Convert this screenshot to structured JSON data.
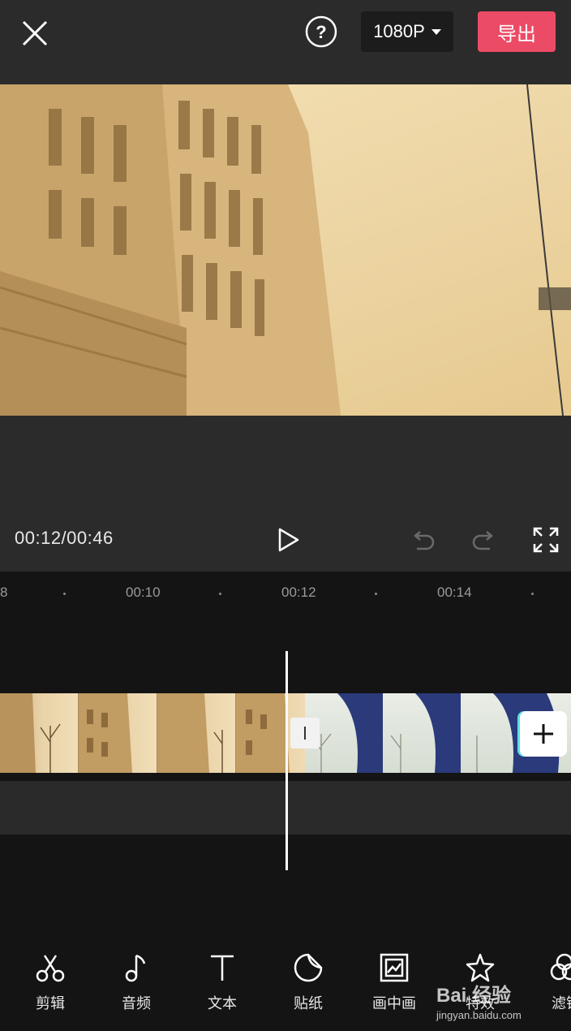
{
  "topbar": {
    "close_icon": "close-icon",
    "help_icon": "help-icon",
    "resolution": "1080P",
    "export_label": "导出"
  },
  "player": {
    "time_readout": "00:12/00:46",
    "play_icon": "play-icon",
    "undo_icon": "undo-icon",
    "redo_icon": "redo-icon",
    "fullscreen_icon": "fullscreen-icon"
  },
  "timeline": {
    "ticks": [
      {
        "label": "8"
      },
      {
        "label": "00:10"
      },
      {
        "label": "00:12"
      },
      {
        "label": "00:14"
      }
    ],
    "add_clip_icon": "plus-icon"
  },
  "toolbar": {
    "items": [
      {
        "label": "剪辑",
        "icon": "scissors-icon"
      },
      {
        "label": "音频",
        "icon": "music-note-icon"
      },
      {
        "label": "文本",
        "icon": "text-icon"
      },
      {
        "label": "贴纸",
        "icon": "sticker-icon"
      },
      {
        "label": "画中画",
        "icon": "picture-in-picture-icon"
      },
      {
        "label": "特效",
        "icon": "star-effects-icon"
      },
      {
        "label": "滤镜",
        "icon": "filter-icon"
      }
    ]
  },
  "watermark": {
    "main": "Bai 经验",
    "sub": "jingyan.baidu.com"
  }
}
